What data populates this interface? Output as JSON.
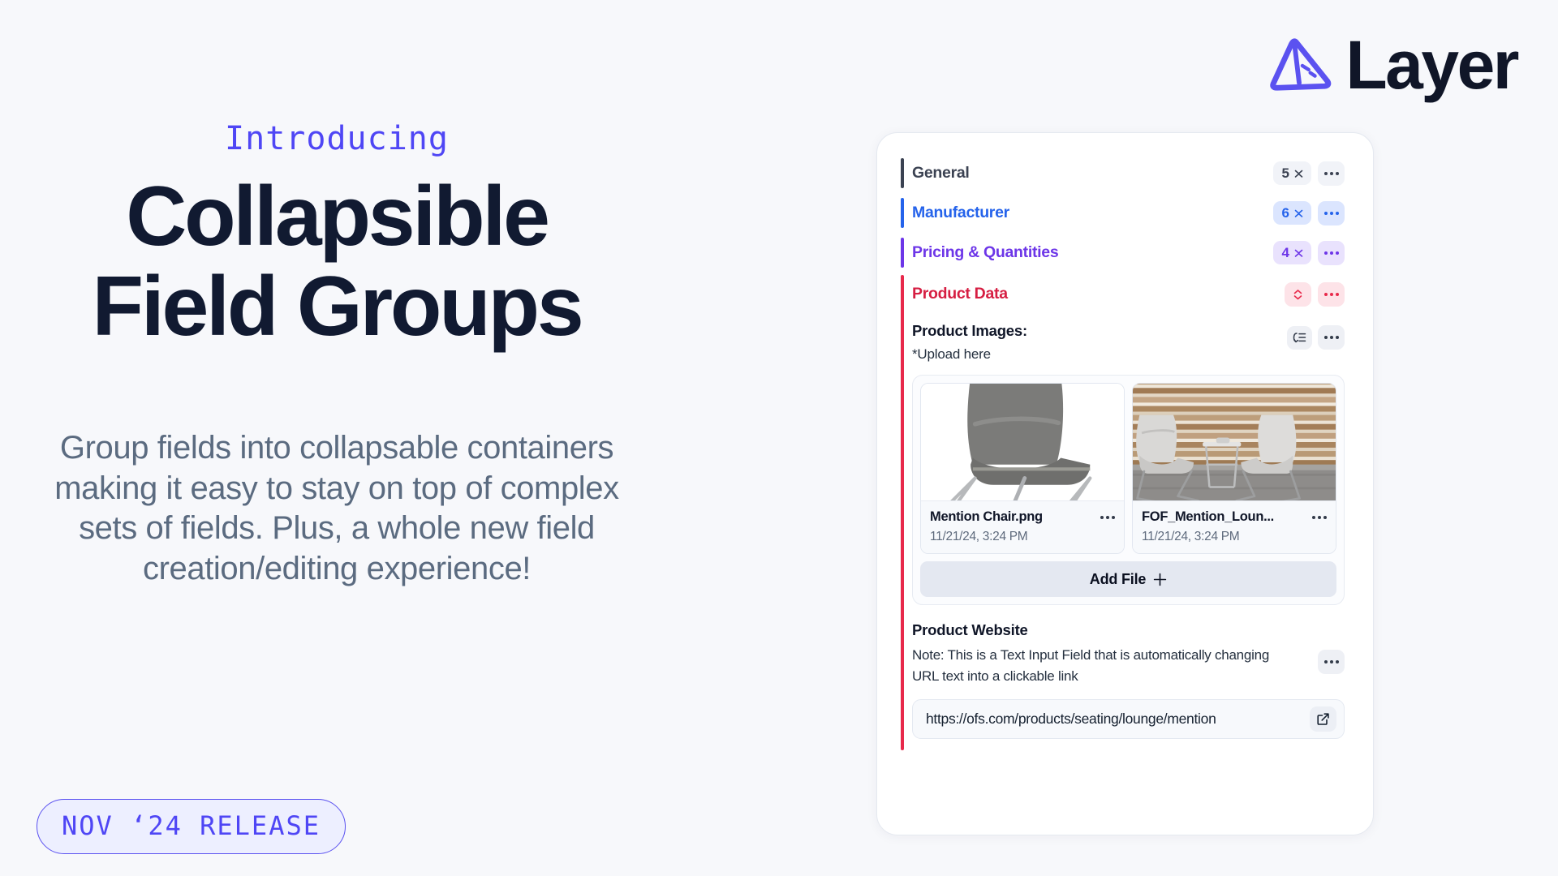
{
  "brand": {
    "name": "Layer",
    "logo_icon": "layer-triangle-logo",
    "accent_color": "#5b52f0",
    "text_color": "#101628"
  },
  "hero": {
    "eyebrow": "Introducing",
    "headline_line1": "Collapsible",
    "headline_line2": "Field Groups",
    "body": "Group fields into collapsable containers making it easy to stay on top of complex sets of fields. Plus, a whole new field creation/editing experience!",
    "release_badge": "NOV ‘24 RELEASE"
  },
  "panel": {
    "groups": [
      {
        "name": "General",
        "count": "5",
        "color": "#3b4252",
        "chip_bg": "#f1f3f8",
        "expanded": false,
        "collapse_icon": "chevron-collapse-icon",
        "menu_icon": "more-options-icon"
      },
      {
        "name": "Manufacturer",
        "count": "6",
        "color": "#2563eb",
        "chip_bg": "#dbe5fe",
        "expanded": false,
        "collapse_icon": "chevron-collapse-icon",
        "menu_icon": "more-options-icon"
      },
      {
        "name": "Pricing & Quantities",
        "count": "4",
        "color": "#6d36e8",
        "chip_bg": "#e9e2fd",
        "expanded": false,
        "collapse_icon": "chevron-collapse-icon",
        "menu_icon": "more-options-icon"
      },
      {
        "name": "Product Data",
        "count": "",
        "color": "#e8294b",
        "chip_bg": "#fde3e8",
        "expanded": true,
        "collapse_icon": "chevron-expand-icon",
        "menu_icon": "more-options-icon"
      }
    ],
    "product_images": {
      "label": "Product Images:",
      "sublabel": "*Upload here",
      "list_icon": "indent-list-icon",
      "menu_icon": "more-options-icon",
      "files": [
        {
          "name": "Mention Chair.png",
          "date": "11/21/24, 3:24 PM",
          "menu_icon": "more-options-icon",
          "image": "grey-lounge-chair"
        },
        {
          "name": "FOF_Mention_Loun...",
          "date": "11/21/24, 3:24 PM",
          "menu_icon": "more-options-icon",
          "image": "lounge-room-scene"
        }
      ],
      "add_file_label": "Add File",
      "add_file_icon": "plus-icon"
    },
    "product_website": {
      "label": "Product Website",
      "note": "Note: This is a Text Input Field that is automatically changing URL text into a clickable link",
      "menu_icon": "more-options-icon",
      "url_value": "https://ofs.com/products/seating/lounge/mention",
      "open_icon": "external-link-icon"
    }
  }
}
